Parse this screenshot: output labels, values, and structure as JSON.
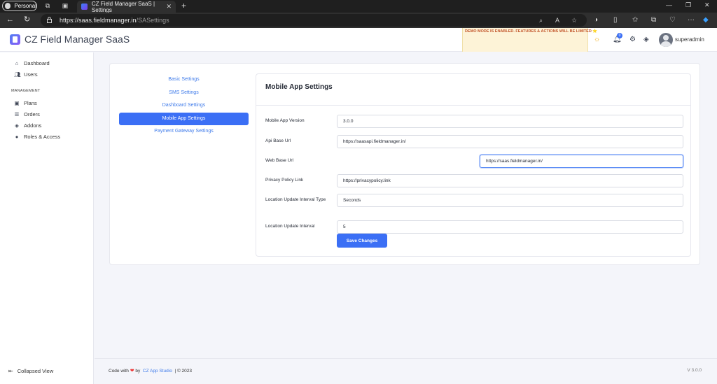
{
  "browser": {
    "profile_label": "Personal",
    "tab_title": "CZ Field Manager SaaS | Settings",
    "url_host": "https://saas.fieldmanager.in",
    "url_path": "/SASettings"
  },
  "header": {
    "brand": "CZ Field Manager SaaS",
    "demo_notice": "DEMO MODE IS ENABLED. FEATURES & ACTIONS WILL BE LIMITED ⭐",
    "notification_count": "0",
    "username": "superadmin"
  },
  "sidebar": {
    "items": [
      {
        "label": "Dashboard",
        "icon": "home-icon"
      },
      {
        "label": "Users",
        "icon": "users-icon"
      }
    ],
    "section_label": "MANAGEMENT",
    "management_items": [
      {
        "label": "Plans",
        "icon": "plans-icon"
      },
      {
        "label": "Orders",
        "icon": "orders-icon"
      },
      {
        "label": "Addons",
        "icon": "layers-icon"
      },
      {
        "label": "Roles & Access",
        "icon": "shield-icon"
      }
    ],
    "collapse_label": "Collapsed View"
  },
  "settings_menu": [
    {
      "label": "Basic Settings",
      "active": false
    },
    {
      "label": "SMS Settings",
      "active": false
    },
    {
      "label": "Dashboard Settings",
      "active": false
    },
    {
      "label": "Mobile App Settings",
      "active": true
    },
    {
      "label": "Payment Gateway Settings",
      "active": false
    }
  ],
  "form": {
    "title": "Mobile App Settings",
    "fields": [
      {
        "label": "Mobile App Version",
        "value": "3.0.0"
      },
      {
        "label": "Api Base Url",
        "value": "https://saasapi.fieldmanager.in/"
      },
      {
        "label": "Web Base Url",
        "value": "https://saas.fieldmanager.in/"
      },
      {
        "label": "Privacy Policy Link",
        "value": "https://privacypolicy.link"
      },
      {
        "label": "Location Update Interval Type",
        "value": "Seconds"
      },
      {
        "label": "Location Update Interval",
        "value": "5"
      }
    ],
    "save_label": "Save Changes"
  },
  "footer": {
    "code_with": "Code with",
    "by": "by",
    "studio": "CZ App Studio",
    "year": "| © 2023",
    "version": "V 3.0.0"
  },
  "colors": {
    "accent": "#3b6ff5",
    "link": "#3f7bea",
    "demo_bg": "#fdf3d7",
    "demo_text": "#c2552b"
  }
}
